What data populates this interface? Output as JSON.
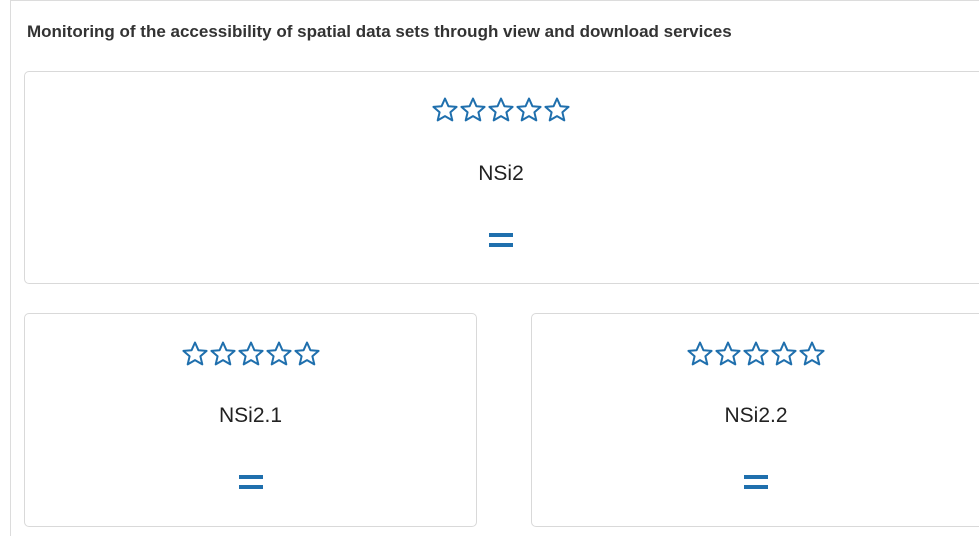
{
  "panel": {
    "title": "Monitoring of the accessibility of spatial data sets through view and download services"
  },
  "colors": {
    "accent": "#1f6fad",
    "border": "#d9d9d9",
    "text": "#222222"
  },
  "cards": [
    {
      "label": "NSi2",
      "rating_filled": 0,
      "rating_max": 5,
      "icon": "star-outline-icon",
      "trend": "=",
      "trend_icon": "equals-icon"
    },
    {
      "label": "NSi2.1",
      "rating_filled": 0,
      "rating_max": 5,
      "icon": "star-outline-icon",
      "trend": "=",
      "trend_icon": "equals-icon"
    },
    {
      "label": "NSi2.2",
      "rating_filled": 0,
      "rating_max": 5,
      "icon": "star-outline-icon",
      "trend": "=",
      "trend_icon": "equals-icon"
    }
  ]
}
